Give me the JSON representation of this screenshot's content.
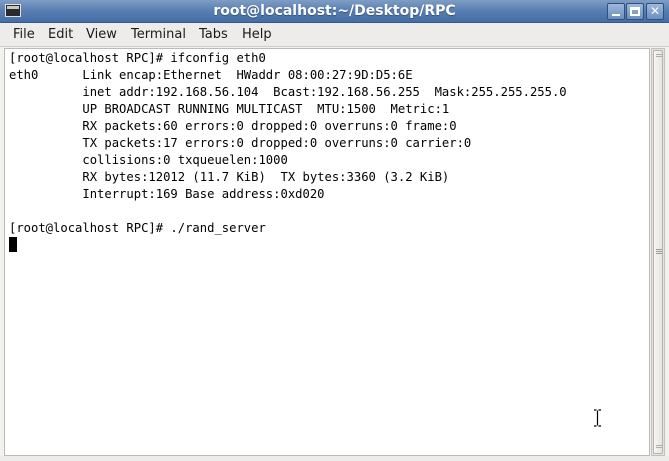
{
  "window": {
    "title": "root@localhost:~/Desktop/RPC"
  },
  "menu": {
    "items": [
      "File",
      "Edit",
      "View",
      "Terminal",
      "Tabs",
      "Help"
    ]
  },
  "terminal": {
    "lines": [
      "[root@localhost RPC]# ifconfig eth0",
      "eth0      Link encap:Ethernet  HWaddr 08:00:27:9D:D5:6E  ",
      "          inet addr:192.168.56.104  Bcast:192.168.56.255  Mask:255.255.255.0",
      "          UP BROADCAST RUNNING MULTICAST  MTU:1500  Metric:1",
      "          RX packets:60 errors:0 dropped:0 overruns:0 frame:0",
      "          TX packets:17 errors:0 dropped:0 overruns:0 carrier:0",
      "          collisions:0 txqueuelen:1000 ",
      "          RX bytes:12012 (11.7 KiB)  TX bytes:3360 (3.2 KiB)",
      "          Interrupt:169 Base address:0xd020 ",
      "",
      "[root@localhost RPC]# ./rand_server"
    ]
  },
  "icons": [
    "terminal-app-icon",
    "minimize-icon",
    "maximize-icon",
    "close-icon",
    "text-cursor-icon"
  ]
}
